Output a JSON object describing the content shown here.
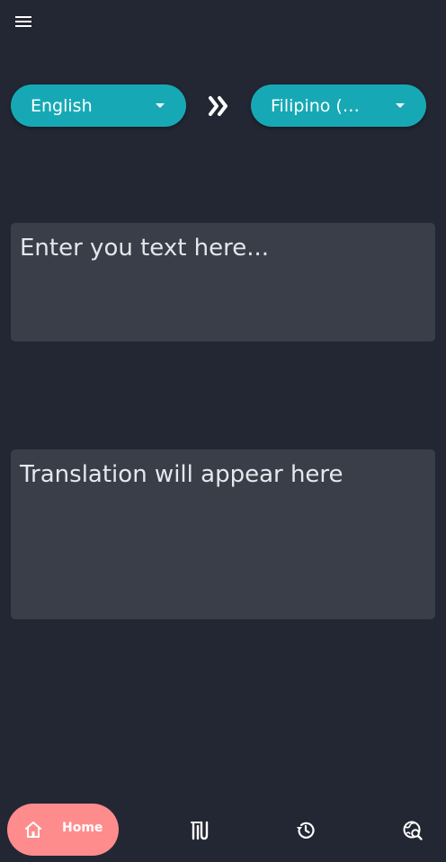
{
  "header": {
    "menu_icon": "menu-icon"
  },
  "languages": {
    "source": "English",
    "target": "Filipino (Tagalog)",
    "swap_icon": "double-chevron-right-icon",
    "dropdown_icon": "caret-down-icon"
  },
  "input": {
    "placeholder": "Enter you text here...",
    "value": ""
  },
  "output": {
    "placeholder": "Translation will appear here"
  },
  "bottom_nav": {
    "items": [
      {
        "label": "Home",
        "icon": "home-icon",
        "active": true
      },
      {
        "label": "",
        "icon": "phrasebook-icon",
        "active": false
      },
      {
        "label": "",
        "icon": "history-icon",
        "active": false
      },
      {
        "label": "",
        "icon": "globe-search-icon",
        "active": false
      }
    ]
  },
  "colors": {
    "background": "#232733",
    "card": "#3a3e49",
    "accent": "#16a9b5",
    "nav_active": "#ff8c8c",
    "text": "#e6e8ec"
  }
}
